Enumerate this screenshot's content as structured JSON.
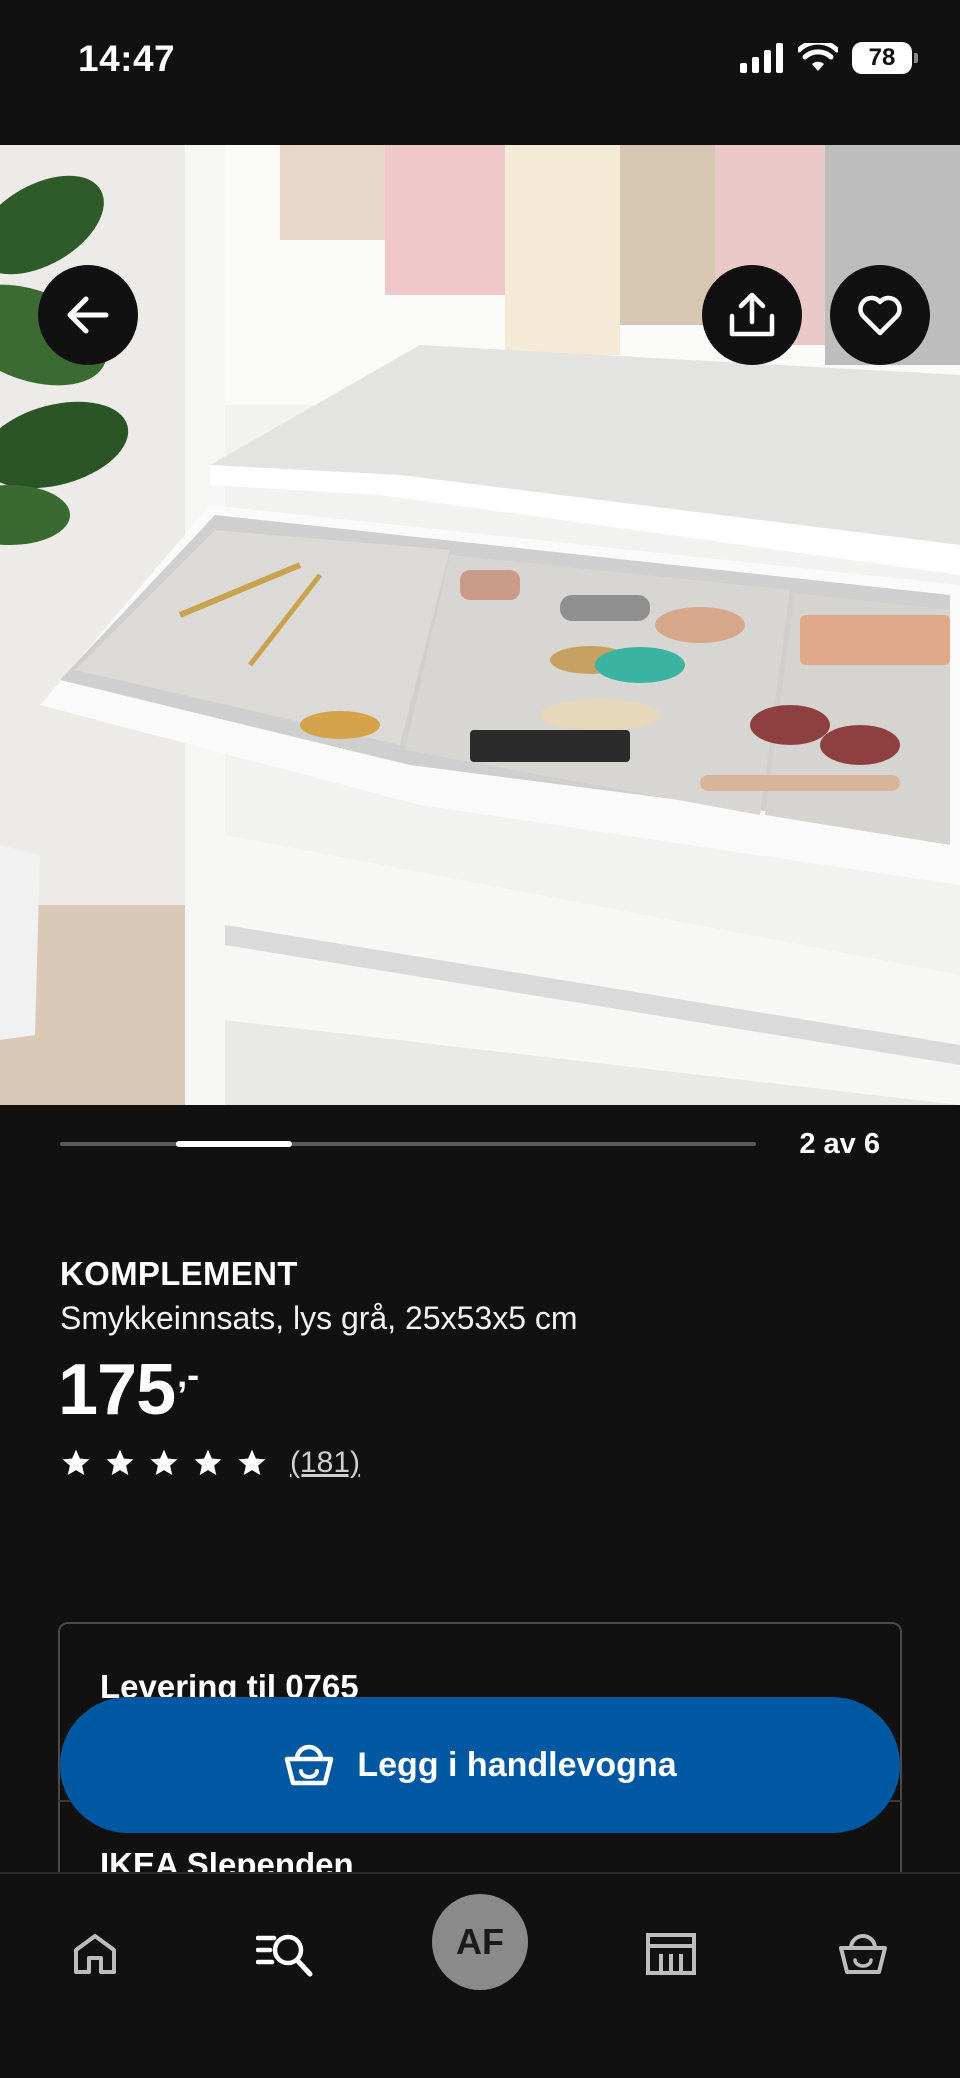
{
  "status_bar": {
    "time": "14:47",
    "battery": "78"
  },
  "carousel": {
    "indicator": "2 av 6",
    "current": 2,
    "total": 6
  },
  "product": {
    "name": "KOMPLEMENT",
    "description": "Smykkeinnsats, lys grå, 25x53x5 cm",
    "price": "175",
    "price_suffix": ",-",
    "rating_stars": 5,
    "rating_count": "(181)"
  },
  "delivery": {
    "title": "Levering til 0765",
    "store": "IKEA Slependen"
  },
  "cart_button": {
    "label": "Legg i handlevogna"
  },
  "nav": {
    "account_initials": "AF"
  },
  "colors": {
    "accent": "#0058a3",
    "background": "#111111"
  }
}
